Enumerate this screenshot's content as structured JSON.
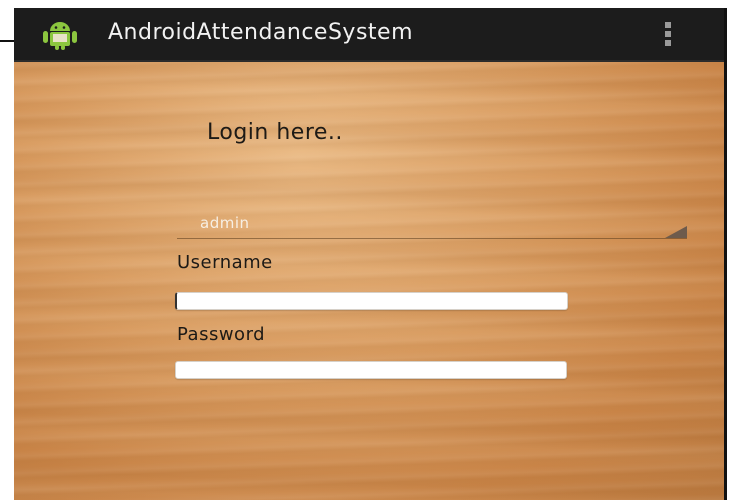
{
  "action_bar": {
    "title": "AndroidAttendanceSystem",
    "app_icon": "android-robot-icon",
    "overflow_icon": "overflow-menu-icon",
    "background_color": "#1c1c1c"
  },
  "login": {
    "heading": "Login here..",
    "role_spinner": {
      "selected": "admin"
    },
    "username": {
      "label": "Username",
      "value": ""
    },
    "password": {
      "label": "Password",
      "value": ""
    }
  },
  "colors": {
    "android_green": "#8cc63f",
    "wood_background": "#d89a5e"
  }
}
